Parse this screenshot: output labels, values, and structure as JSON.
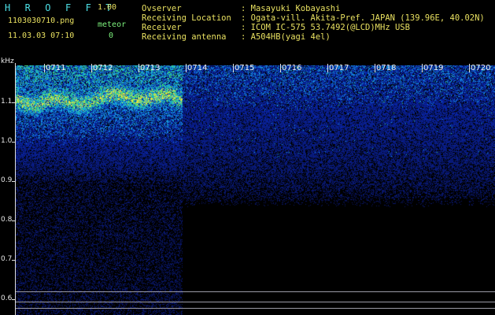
{
  "header": {
    "app_title": "H R O F F T",
    "version": "1.00",
    "file_name": "1103030710.png",
    "meteor_label": "meteor",
    "date_time": "11.03.03 07:10",
    "meteor_count": "0"
  },
  "station_info": [
    {
      "label": "Ovserver",
      "value": ": Masayuki Kobayashi"
    },
    {
      "label": "Receiving Location",
      "value": ": Ogata-vill. Akita-Pref. JAPAN (139.96E, 40.02N)"
    },
    {
      "label": "Receiver",
      "value": ": ICOM IC-575 53.7492(@LCD)MHz USB"
    },
    {
      "label": "Receiving antenna",
      "value": ": A504HB(yagi 4el)"
    }
  ],
  "spectrogram": {
    "freq_unit": "kHz",
    "freq_ticks": [
      "1.1",
      "1.0",
      "0.9",
      "0.8",
      "0.7",
      "0.6"
    ],
    "time_ticks": [
      "0711",
      "0712",
      "0713",
      "0714",
      "0715",
      "0716",
      "0717",
      "0718",
      "0719",
      "0720"
    ],
    "colors": {
      "background": "#000000",
      "noise_low": "#0a1a8a",
      "noise_mid": "#1a4ed8",
      "signal": "#3cd080",
      "peak": "#e0e040"
    }
  }
}
